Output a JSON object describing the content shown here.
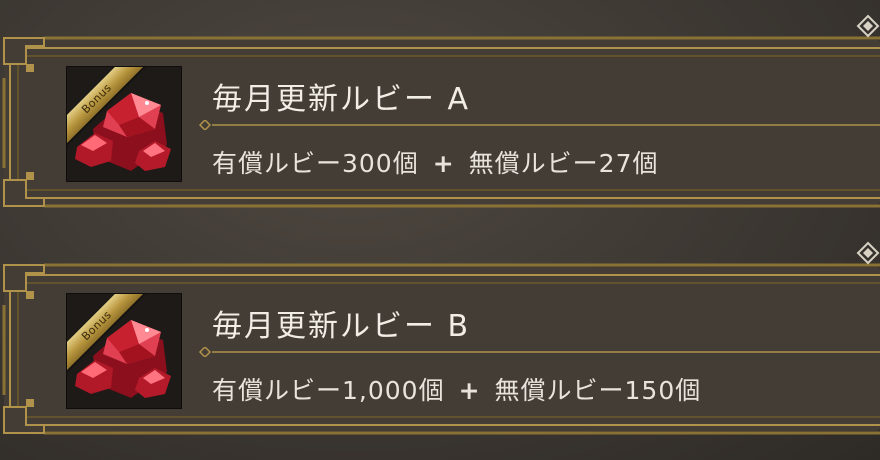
{
  "badge_label": "Bonus",
  "items": [
    {
      "title": "毎月更新ルビー A",
      "paid": "有償ルビー300個",
      "plus": "+",
      "free": "無償ルビー27個"
    },
    {
      "title": "毎月更新ルビー B",
      "paid": "有償ルビー1,000個",
      "plus": "+",
      "free": "無償ルビー150個"
    }
  ],
  "colors": {
    "frame_gold": "#a88a3f",
    "panel": "#433d36",
    "background": "#3b3631",
    "ruby": "#d42a3a"
  }
}
